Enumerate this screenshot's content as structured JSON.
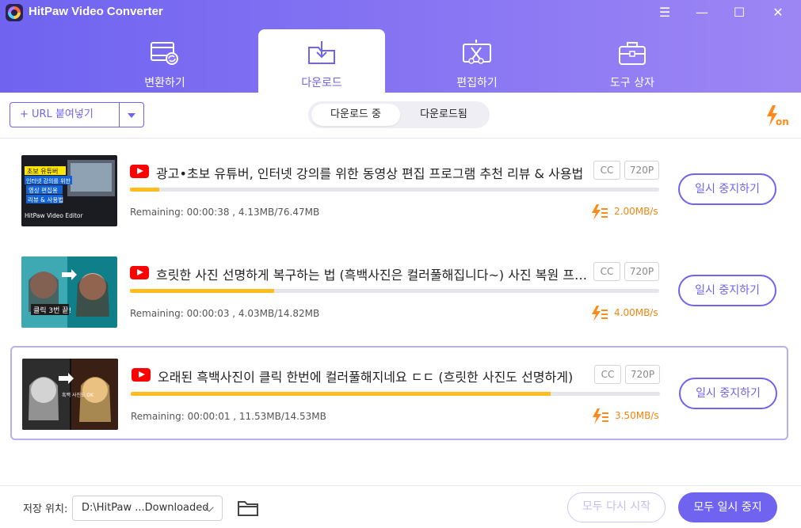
{
  "app": {
    "title": "HitPaw Video Converter"
  },
  "window_controls": {
    "menu": "☰",
    "minimize": "—",
    "maximize": "☐",
    "close": "✕"
  },
  "tabs": [
    {
      "label": "변환하기",
      "icon": "film-convert-icon",
      "active": false
    },
    {
      "label": "다운로드",
      "icon": "folder-download-icon",
      "active": true
    },
    {
      "label": "편집하기",
      "icon": "edit-scissors-icon",
      "active": false
    },
    {
      "label": "도구 상자",
      "icon": "toolbox-icon",
      "active": false
    }
  ],
  "toolbar": {
    "url_paste_label": "+ URL 붙여넣기",
    "segment": {
      "downloading": "다운로드 중",
      "downloaded": "다운로드됨"
    },
    "speed_mode_text": "on"
  },
  "downloads": [
    {
      "title": "광고•초보 유튜버, 인터넷 강의를 위한 동영상 편집 프로그램 추천 리뷰 & 사용법",
      "cc": "CC",
      "quality": "720P",
      "progress": 0.055,
      "remaining": "Remaining: 00:00:38 , 4.13MB/76.47MB",
      "speed": "2.00MB/s",
      "action": "일시 중지하기",
      "thumb_text": {
        "line1": "초보 유튜버",
        "line2": "인터넷 강의를 위한",
        "line3": "영상 편집용",
        "line4": "리뷰 & 사용법",
        "brand": "HitPaw Video Editor"
      }
    },
    {
      "title": "흐릿한 사진 선명하게 복구하는 법 (흑백사진은 컬러풀해집니다~) 사진 복원 프로그램",
      "cc": "CC",
      "quality": "720P",
      "progress": 0.272,
      "remaining": "Remaining: 00:00:03 , 4.03MB/14.82MB",
      "speed": "4.00MB/s",
      "action": "일시 중지하기",
      "thumb_text": {
        "caption": "클릭 3번 끝!"
      }
    },
    {
      "title": "오래된 흑백사진이 클릭 한번에 컬러풀해지네요 ㄷㄷ (흐릿한 사진도 선명하게)",
      "cc": "CC",
      "quality": "720P",
      "progress": 0.794,
      "remaining": "Remaining: 00:00:01 , 11.53MB/14.53MB",
      "speed": "3.50MB/s",
      "action": "일시 중지하기",
      "thumb_text": {
        "caption": "흑백 사진도 OK"
      }
    }
  ],
  "footer": {
    "save_location_label": "저장 위치:",
    "save_path": "D:\\HitPaw ...Downloaded",
    "resume_all": "모두 다시 시작",
    "pause_all": "모두 일시 중지"
  },
  "colors": {
    "accent": "#6f63f0",
    "progress": "#ffbc1f",
    "speed": "#f58410",
    "youtube": "#ff0000"
  }
}
